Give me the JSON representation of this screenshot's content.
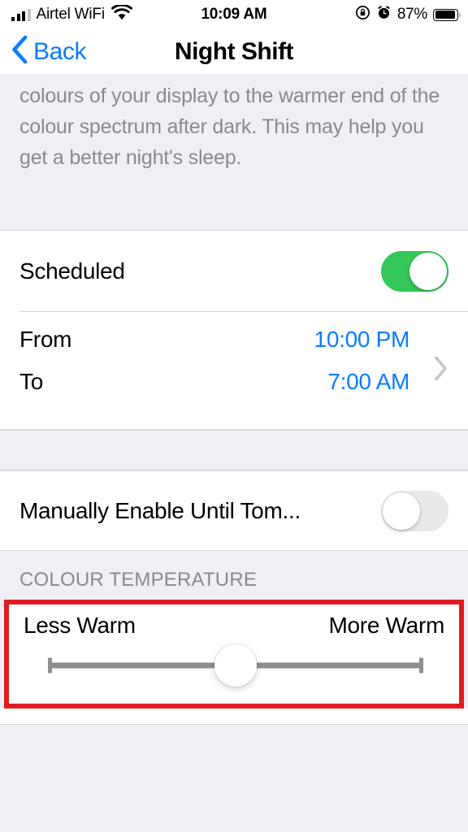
{
  "status_bar": {
    "carrier": "Airtel WiFi",
    "wifi_icon": "wifi-icon",
    "signal_icon": "signal-bars-icon",
    "time": "10:09 AM",
    "rotation_lock_icon": "rotation-lock-icon",
    "alarm_icon": "alarm-clock-icon",
    "battery_percent": "87%",
    "battery_icon": "battery-full-icon"
  },
  "nav": {
    "back_label": "Back",
    "back_icon": "chevron-left-icon",
    "title": "Night Shift"
  },
  "description": {
    "text": "colours of your display to the warmer end of the colour spectrum after dark. This may help you get a better night's sleep."
  },
  "scheduled_section": {
    "label": "Scheduled",
    "toggle_state": "on",
    "from_label": "From",
    "from_value": "10:00 PM",
    "to_label": "To",
    "to_value": "7:00 AM",
    "disclosure_icon": "chevron-right-icon"
  },
  "manual_section": {
    "label": "Manually Enable Until Tom...",
    "toggle_state": "off"
  },
  "colour_temperature": {
    "header": "COLOUR TEMPERATURE",
    "less_warm_label": "Less Warm",
    "more_warm_label": "More Warm",
    "slider_value_percent": 50,
    "highlighted": true
  },
  "colors": {
    "accent_blue": "#0a7cff",
    "toggle_on_green": "#34c759",
    "toggle_off_gray": "#e9e9ea",
    "highlight_red": "#e01b22",
    "group_background": "#f0eff4",
    "secondary_text": "#8a8a8e",
    "track_gray": "#8e8e93"
  }
}
